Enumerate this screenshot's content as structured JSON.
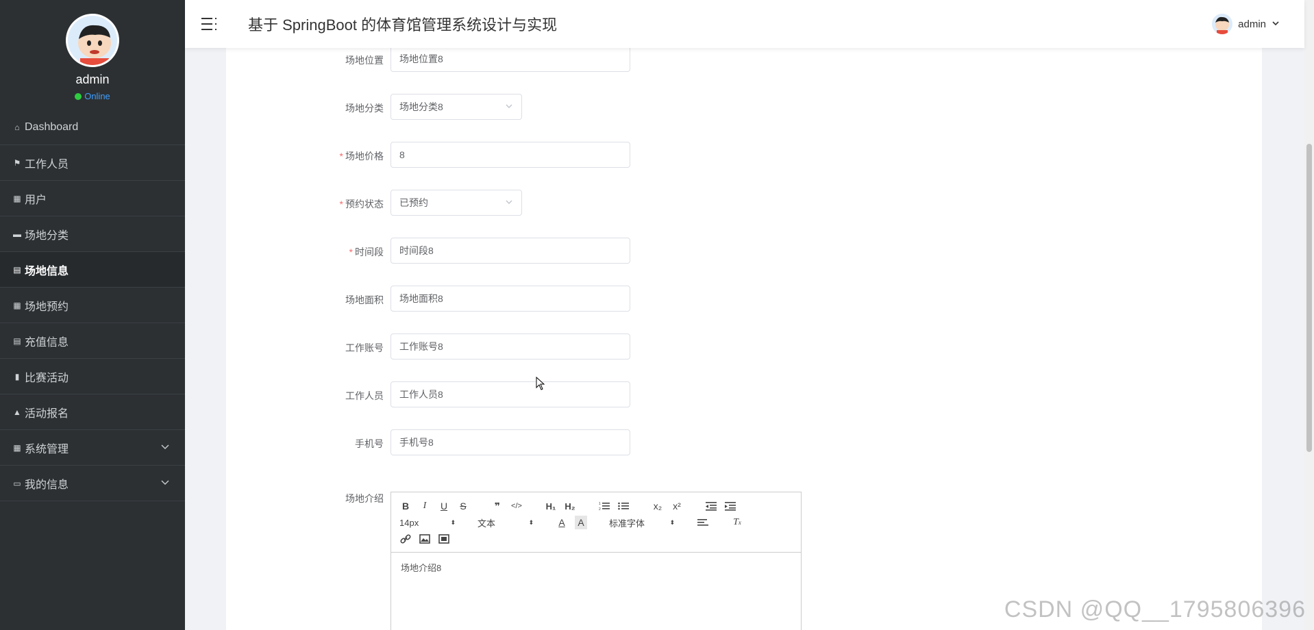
{
  "header": {
    "title": "基于 SpringBoot 的体育馆管理系统设计与实现",
    "user_label": "admin"
  },
  "sidebar": {
    "profile_name": "admin",
    "profile_status": "Online",
    "items": [
      {
        "label": "Dashboard",
        "icon": "home-icon"
      },
      {
        "label": "工作人员",
        "icon": "flag-icon"
      },
      {
        "label": "用户",
        "icon": "grid-icon"
      },
      {
        "label": "场地分类",
        "icon": "briefcase-icon"
      },
      {
        "label": "场地信息",
        "icon": "clipboard-icon"
      },
      {
        "label": "场地预约",
        "icon": "grid-icon"
      },
      {
        "label": "充值信息",
        "icon": "clipboard-icon"
      },
      {
        "label": "比赛活动",
        "icon": "bar-chart-icon"
      },
      {
        "label": "活动报名",
        "icon": "thumbs-up-icon"
      },
      {
        "label": "系统管理",
        "icon": "grid-icon"
      },
      {
        "label": "我的信息",
        "icon": "card-icon"
      }
    ]
  },
  "form": {
    "location": {
      "label": "场地位置",
      "value": "场地位置8"
    },
    "category": {
      "label": "场地分类",
      "value": "场地分类8"
    },
    "price": {
      "label": "场地价格",
      "value": "8"
    },
    "status": {
      "label": "预约状态",
      "value": "已预约"
    },
    "time_slot": {
      "label": "时间段",
      "value": "时间段8"
    },
    "area": {
      "label": "场地面积",
      "value": "场地面积8"
    },
    "staff_account": {
      "label": "工作账号",
      "value": "工作账号8"
    },
    "staff_name": {
      "label": "工作人员",
      "value": "工作人员8"
    },
    "phone": {
      "label": "手机号",
      "value": "手机号8"
    },
    "intro": {
      "label": "场地介绍",
      "value": "场地介绍8"
    }
  },
  "editor": {
    "font_size": "14px",
    "header_type": "文本",
    "font_family": "标准字体"
  },
  "watermark": "CSDN @QQ__1795806396"
}
